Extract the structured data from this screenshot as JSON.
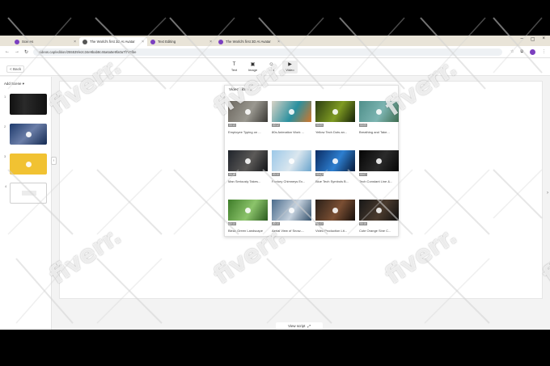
{
  "browser": {
    "tabs": [
      {
        "label": "Scenes",
        "icon": "app-icon",
        "active": false
      },
      {
        "label": "The World's first 3D AI Avatar",
        "icon": "globe-icon",
        "active": true
      },
      {
        "label": "Text Editing",
        "icon": "app-icon",
        "active": false
      },
      {
        "label": "The World's first 3D AI Avatar",
        "icon": "app-icon",
        "active": false
      }
    ],
    "url": "videos.cap/edition/255539/e2c34e9bab8c46a6a5e9fa0a7f749fbe"
  },
  "app": {
    "back_label": "< Back",
    "toolbar": [
      {
        "label": "Text",
        "icon": "text-icon",
        "glyph": "T"
      },
      {
        "label": "Image",
        "icon": "image-icon",
        "glyph": "▣"
      },
      {
        "label": "Icon",
        "icon": "icon-icon",
        "glyph": "☺"
      },
      {
        "label": "Video",
        "icon": "video-icon",
        "glyph": "▶"
      }
    ],
    "add_scene_label": "Add Scene ▾",
    "scenes": [
      "1",
      "2",
      "3",
      "4"
    ],
    "view_script_label": "View script",
    "view_script_glyph": "⤢"
  },
  "library": {
    "title": "Video Library",
    "items": [
      {
        "title": "Employee Typing on ...",
        "duration": "00:13",
        "colors": [
          "#6d6860",
          "#9a9890",
          "#3a3834"
        ]
      },
      {
        "title": "80s Animation Work ...",
        "duration": "00:12",
        "colors": [
          "#d9d3c6",
          "#2a8f9e",
          "#d2762a"
        ]
      },
      {
        "title": "Yellow Tech Dots an...",
        "duration": "00:09",
        "colors": [
          "#2b3d12",
          "#7f9b22",
          "#142009"
        ]
      },
      {
        "title": "Breathing and Take...",
        "duration": "00:09",
        "colors": [
          "#4f8f8a",
          "#7db5b2",
          "#3d6b4e"
        ]
      },
      {
        "title": "Man Seriously Takes...",
        "duration": "00:18",
        "colors": [
          "#20242b",
          "#5c5a58",
          "#121417"
        ]
      },
      {
        "title": "Factory Chimneys Ex...",
        "duration": "00:10",
        "colors": [
          "#9cc8e8",
          "#dbe7ef",
          "#6aa4cc"
        ]
      },
      {
        "title": "Blue Tech Symbols B...",
        "duration": "00:07",
        "colors": [
          "#0b2c63",
          "#2d7fd0",
          "#061838"
        ]
      },
      {
        "title": "Tech Constant Line &...",
        "duration": "00:07",
        "colors": [
          "#050505",
          "#2b2b2b",
          "#050505"
        ]
      },
      {
        "title": "Bleak Green Landscape",
        "duration": "00:14",
        "colors": [
          "#3f7d2a",
          "#8cc46b",
          "#2a5a1e"
        ]
      },
      {
        "title": "Aerial View of Snow-...",
        "duration": "00:10",
        "colors": [
          "#4a6b8c",
          "#c6d2de",
          "#33506b"
        ]
      },
      {
        "title": "Video Production Lit...",
        "duration": "00:13",
        "colors": [
          "#2a2019",
          "#7b4f33",
          "#160f0b"
        ]
      },
      {
        "title": "Cute Orange Sine C...",
        "duration": "00:16",
        "colors": [
          "#181818",
          "#4b3b2e",
          "#0e0e0e"
        ]
      }
    ]
  },
  "watermark": {
    "text": "fiverr."
  },
  "colors": {
    "brand": "#7b3fbf",
    "scene3": "#f1c232"
  }
}
